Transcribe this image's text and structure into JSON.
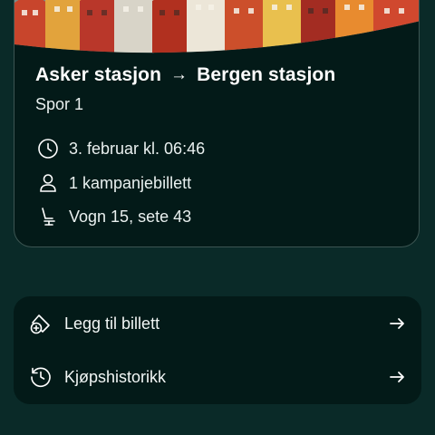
{
  "trip": {
    "from": "Asker stasjon",
    "arrow": "→",
    "to": "Bergen stasjon",
    "track": "Spor 1",
    "departure": "3. februar kl. 06:46",
    "tickets": "1 kampanjebillett",
    "seat": "Vogn 15, sete 43"
  },
  "actions": {
    "add_ticket": "Legg til billett",
    "history": "Kjøpshistorikk"
  },
  "colors": {
    "background": "#0a2a28",
    "card": "#031a18",
    "text": "#ffffff"
  },
  "icons": {
    "departure": "clock-icon",
    "tickets": "person-icon",
    "seat": "seat-icon",
    "add_ticket": "ticket-plus-icon",
    "history": "history-icon",
    "chevron": "arrow-right-icon"
  }
}
